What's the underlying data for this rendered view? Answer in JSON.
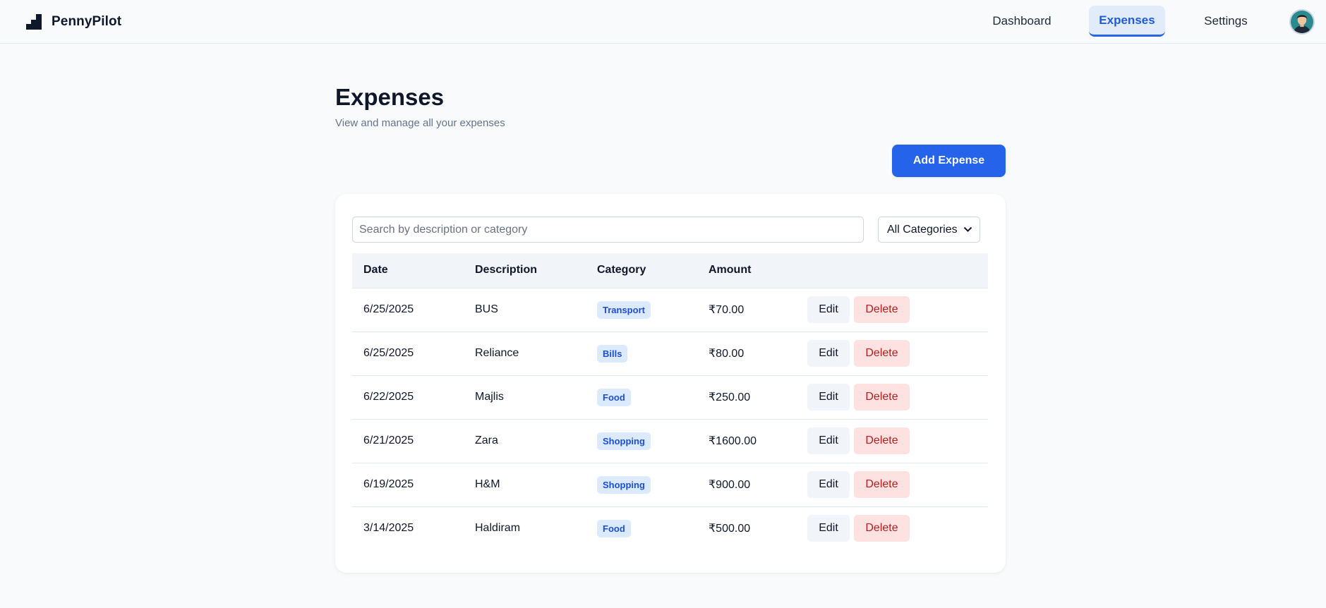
{
  "app": {
    "name": "PennyPilot"
  },
  "nav": {
    "tabs": [
      {
        "label": "Dashboard",
        "active": false
      },
      {
        "label": "Expenses",
        "active": true
      },
      {
        "label": "Settings",
        "active": false
      }
    ]
  },
  "page": {
    "title": "Expenses",
    "subtitle": "View and manage all your expenses",
    "add_button_label": "Add Expense"
  },
  "filters": {
    "search_placeholder": "Search by description or category",
    "search_value": "",
    "category_selected": "All Categories"
  },
  "table": {
    "columns": [
      "Date",
      "Description",
      "Category",
      "Amount",
      ""
    ],
    "edit_label": "Edit",
    "delete_label": "Delete",
    "rows": [
      {
        "date": "6/25/2025",
        "description": "BUS",
        "category": "Transport",
        "amount": "₹70.00"
      },
      {
        "date": "6/25/2025",
        "description": "Reliance",
        "category": "Bills",
        "amount": "₹80.00"
      },
      {
        "date": "6/22/2025",
        "description": "Majlis",
        "category": "Food",
        "amount": "₹250.00"
      },
      {
        "date": "6/21/2025",
        "description": "Zara",
        "category": "Shopping",
        "amount": "₹1600.00"
      },
      {
        "date": "6/19/2025",
        "description": "H&M",
        "category": "Shopping",
        "amount": "₹900.00"
      },
      {
        "date": "3/14/2025",
        "description": "Haldiram",
        "category": "Food",
        "amount": "₹500.00"
      }
    ]
  },
  "icons": {
    "logo": "bar-steps-logo-icon",
    "avatar": "user-avatar",
    "select": "chevron-down-icon"
  },
  "colors": {
    "primary": "#2563eb",
    "danger_bg": "#fee2e2",
    "danger_text": "#b91c1c",
    "badge_bg": "#dbeafe",
    "badge_text": "#1d4ed8"
  }
}
